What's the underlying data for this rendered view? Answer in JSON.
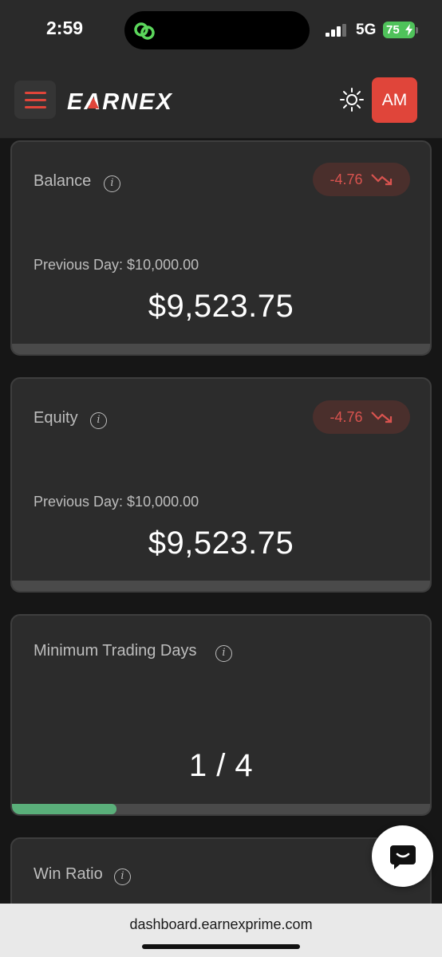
{
  "status_bar": {
    "time": "2:59",
    "network": "5G",
    "battery": "75"
  },
  "header": {
    "brand": "EARNEX",
    "avatar_initials": "AM",
    "accent_color": "#e0453a"
  },
  "cards": {
    "balance": {
      "title": "Balance",
      "info": "i",
      "delta": "-4.76",
      "previous_day": "Previous Day: $10,000.00",
      "value": "$9,523.75"
    },
    "equity": {
      "title": "Equity",
      "info": "i",
      "delta": "-4.76",
      "previous_day": "Previous Day: $10,000.00",
      "value": "$9,523.75"
    },
    "min_trading_days": {
      "title": "Minimum Trading Days",
      "info": "i",
      "value": "1 / 4",
      "progress_fraction": 0.25
    },
    "win_ratio": {
      "title": "Win Ratio",
      "info": "i"
    }
  },
  "browser": {
    "url": "dashboard.earnexprime.com"
  },
  "icons": {
    "menu": "hamburger-icon",
    "theme": "sun-icon",
    "info": "info-icon",
    "trend": "trend-down-icon",
    "chat": "chat-icon"
  },
  "colors": {
    "negative": "#d9534f",
    "progress": "#5aaf7a",
    "battery": "#4fc25a"
  }
}
